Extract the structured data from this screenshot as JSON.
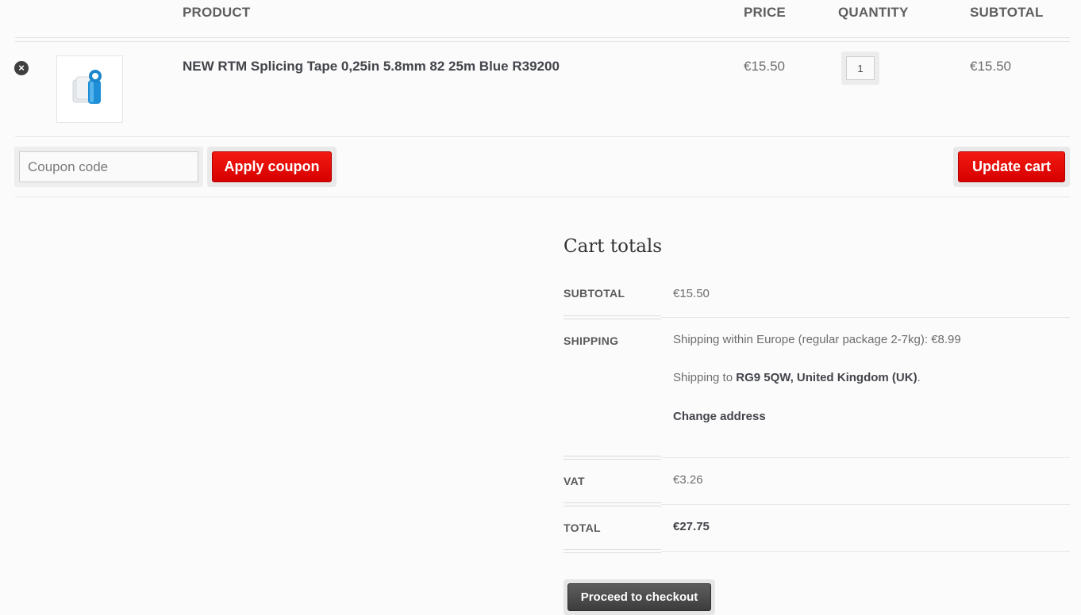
{
  "cart_table": {
    "headers": {
      "product": "PRODUCT",
      "price": "PRICE",
      "quantity": "QUANTITY",
      "subtotal": "SUBTOTAL"
    },
    "items": [
      {
        "remove_symbol": "×",
        "thumbnail_icon": "blue-tape-reel-image",
        "name": "NEW RTM Splicing Tape 0,25in 5.8mm 82 25m Blue R39200",
        "price": "€15.50",
        "quantity": "1",
        "subtotal": "€15.50"
      }
    ]
  },
  "actions": {
    "coupon_placeholder": "Coupon code",
    "apply_coupon_label": "Apply coupon",
    "update_cart_label": "Update cart"
  },
  "cart_totals": {
    "title": "Cart totals",
    "subtotal_label": "SUBTOTAL",
    "subtotal_value": "€15.50",
    "shipping_label": "SHIPPING",
    "shipping_method": "Shipping within Europe (regular package 2-7kg): €8.99",
    "shipping_to_prefix": "Shipping to ",
    "shipping_destination": "RG9 5QW, United Kingdom (UK)",
    "shipping_to_suffix": ".",
    "change_address_label": "Change address",
    "vat_label": "VAT",
    "vat_value": "€3.26",
    "total_label": "TOTAL",
    "total_value": "€27.75",
    "checkout_label": "Proceed to checkout"
  },
  "colors": {
    "accent_red": "#e10600",
    "dark_button": "#4a4a4a",
    "background": "#fbfbfb"
  }
}
